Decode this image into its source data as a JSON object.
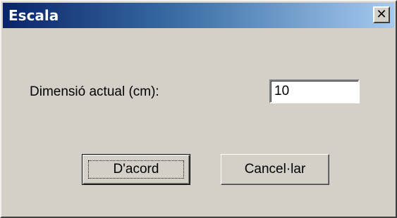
{
  "window": {
    "title": "Escala",
    "close_icon": "close-icon",
    "close_glyph": "✕"
  },
  "form": {
    "label": "Dimensió actual (cm):",
    "value": "10"
  },
  "buttons": {
    "ok_label": "D'acord",
    "cancel_label": "Cancel·lar"
  },
  "colors": {
    "title_bar_start": "#0a246a",
    "title_bar_end": "#a6caf0",
    "window_bg": "#d4d0c8"
  }
}
